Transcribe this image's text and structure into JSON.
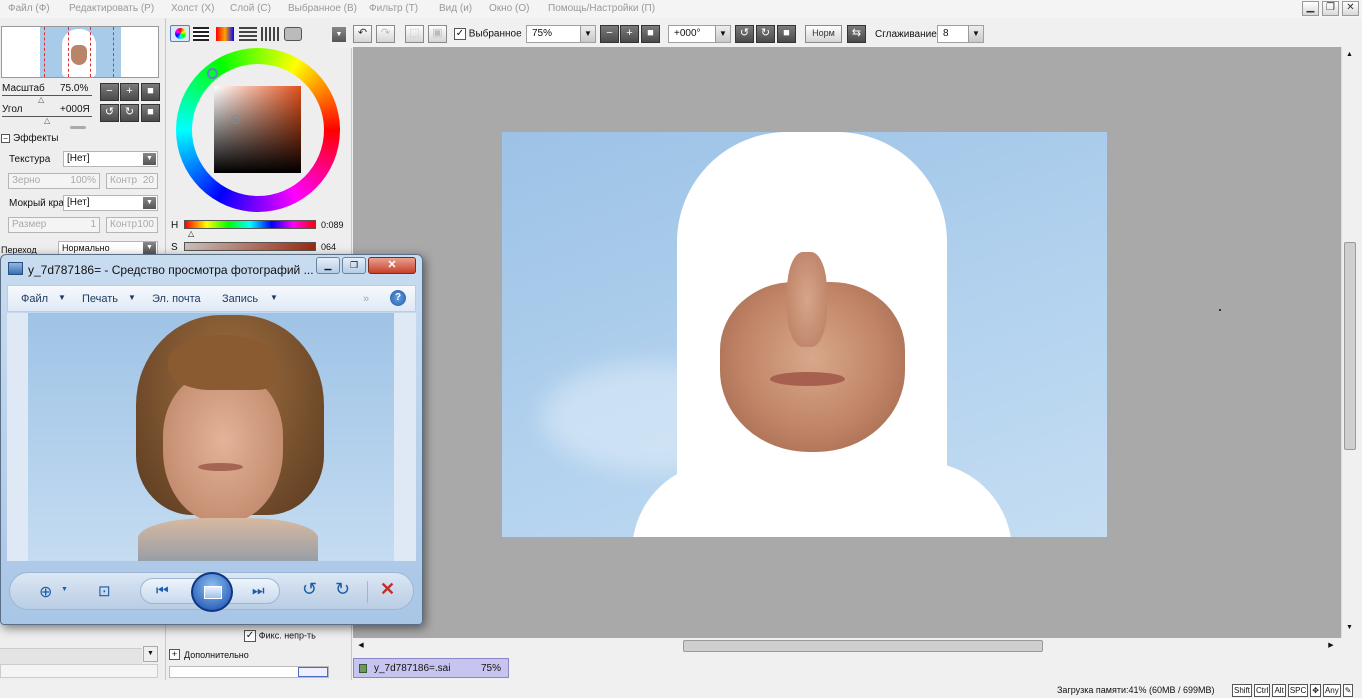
{
  "menubar": {
    "items": [
      "Файл (Ф)",
      "Редактировать (Р)",
      "Холст (Х)",
      "Слой (С)",
      "Выбранное (В)",
      "Фильтр (Т)",
      "Вид (и)",
      "Окно (О)",
      "Помощь/Настройки (П)"
    ]
  },
  "toolbar": {
    "selection_label": "Выбранное",
    "zoom_value": "75%",
    "angle_value": "+000°",
    "norm_label": "Норм",
    "smoothing_label": "Сглаживание",
    "smoothing_value": "8"
  },
  "navigator": {
    "scale_label": "Масштаб",
    "scale_value": "75.0%",
    "angle_label": "Угол",
    "angle_value": "+000Я"
  },
  "effects": {
    "header": "Эффекты",
    "texture_label": "Текстура",
    "texture_value": "[Нет]",
    "grain_label": "Зерно",
    "grain_value": "100%",
    "contrast_label": "Контр",
    "contrast_value": "20",
    "wet_edge_label": "Мокрый край",
    "wet_edge_value": "[Нет]",
    "size_label": "Размер",
    "size_value": "1",
    "contrast2_label": "Контр",
    "contrast2_value": "100",
    "blend_label": "Переход",
    "blend_value": "Нормально"
  },
  "color": {
    "h_label": "H",
    "h_value": "0:089",
    "s_label": "S",
    "s_value": "064",
    "fix_opacity_label": "Фикс. непр-ть",
    "advanced_label": "Дополнительно"
  },
  "viewer": {
    "title": "y_7d787186= - Средство просмотра фотографий ...",
    "menu": [
      "Файл",
      "Печать",
      "Эл. почта",
      "Запись"
    ]
  },
  "doc_tab": {
    "name": "y_7d787186=.sai",
    "zoom": "75%"
  },
  "status": {
    "memory": "Загрузка памяти:41% (60MB / 699MB)",
    "keys": [
      "Shift",
      "Ctrl",
      "Alt",
      "SPC",
      "Any"
    ]
  },
  "colors": {
    "canvas_bg": "#a9a9a9",
    "sky": "#a9cbea",
    "accent": "#3a7bd5"
  }
}
